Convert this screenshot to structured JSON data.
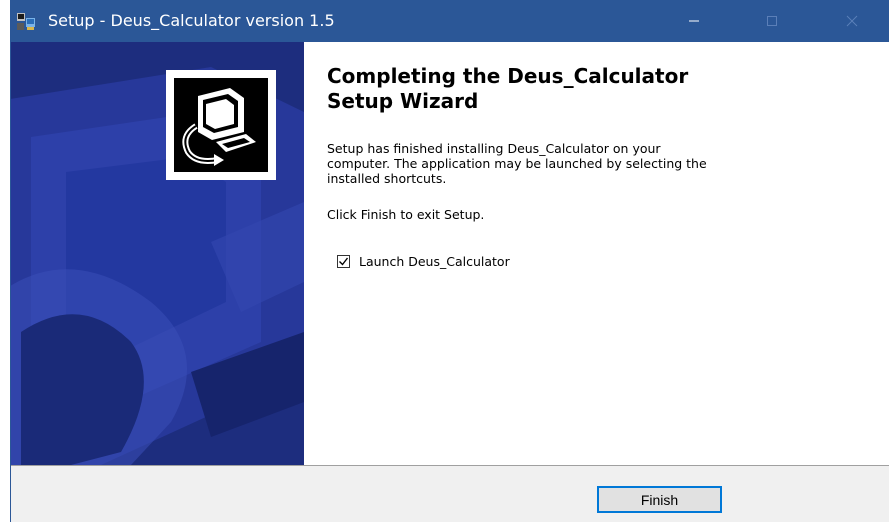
{
  "window": {
    "title": "Setup - Deus_Calculator version 1.5",
    "titlebar_color": "#2b5797",
    "icons": {
      "app": "setup-app-icon",
      "minimize": "minimize-icon",
      "maximize": "maximize-icon",
      "close": "close-icon"
    }
  },
  "side_panel": {
    "color": "#1d2d7e",
    "logo_icon": "computer-install-icon"
  },
  "content": {
    "heading": "Completing the Deus_Calculator\nSetup Wizard",
    "paragraph": "Setup has finished installing Deus_Calculator on your\ncomputer. The application may be launched by selecting the\ninstalled shortcuts.",
    "exit_instruction": "Click Finish to exit Setup.",
    "launch_checkbox": {
      "label": "Launch Deus_Calculator",
      "checked": true
    }
  },
  "footer": {
    "finish_label": "Finish",
    "accent_color": "#0078d7"
  }
}
